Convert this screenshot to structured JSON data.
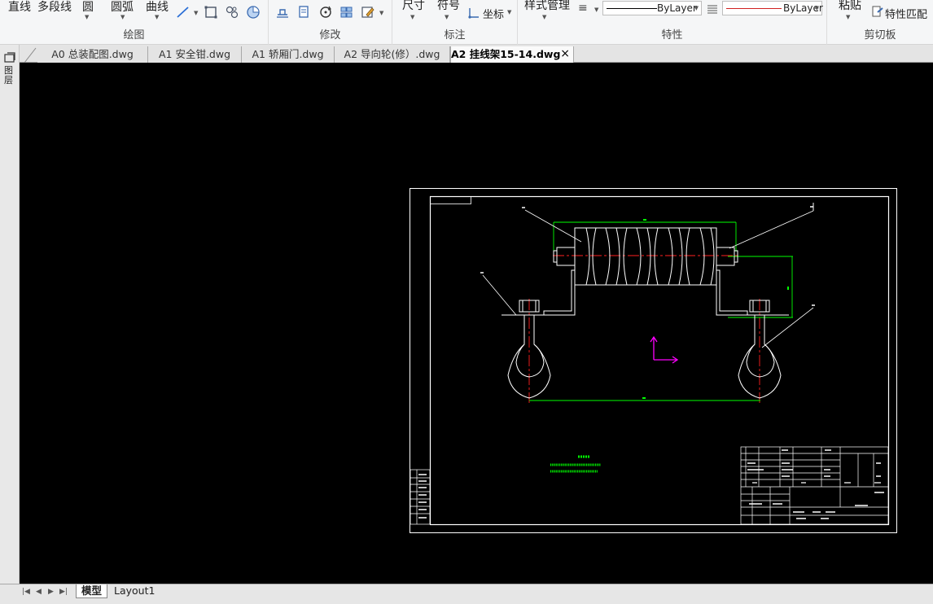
{
  "ribbon": {
    "draw": {
      "line": "直线",
      "polyline": "多段线",
      "circle": "圆",
      "arc": "圆弧",
      "curve": "曲线",
      "group_label": "绘图"
    },
    "modify": {
      "group_label": "修改"
    },
    "annotate": {
      "dimension": "尺寸",
      "symbol": "符号",
      "coordinate": "坐标",
      "group_label": "标注"
    },
    "properties": {
      "style_manager": "样式管理",
      "linetype_value": "ByLayer",
      "color_value": "ByLayer",
      "group_label": "特性"
    },
    "clipboard": {
      "paste": "粘贴",
      "match_properties": "特性匹配",
      "group_label": "剪切板"
    }
  },
  "left_strip": {
    "label": "图层"
  },
  "tabs": [
    {
      "label": "A0 总装配图.dwg"
    },
    {
      "label": "A1 安全钳.dwg"
    },
    {
      "label": "A1 轿厢门.dwg"
    },
    {
      "label": "A2 导向轮(修）.dwg"
    },
    {
      "label": "A2 挂线架15-14.dwg"
    }
  ],
  "bottom": {
    "model_tab": "模型",
    "layout_tab": "Layout1"
  },
  "colors": {
    "canvas_bg": "#000000",
    "drawing_white": "#ffffff",
    "dimension_green": "#00ff00",
    "centerline_red": "#ff2020",
    "ucs_magenta": "#ff00ff"
  }
}
